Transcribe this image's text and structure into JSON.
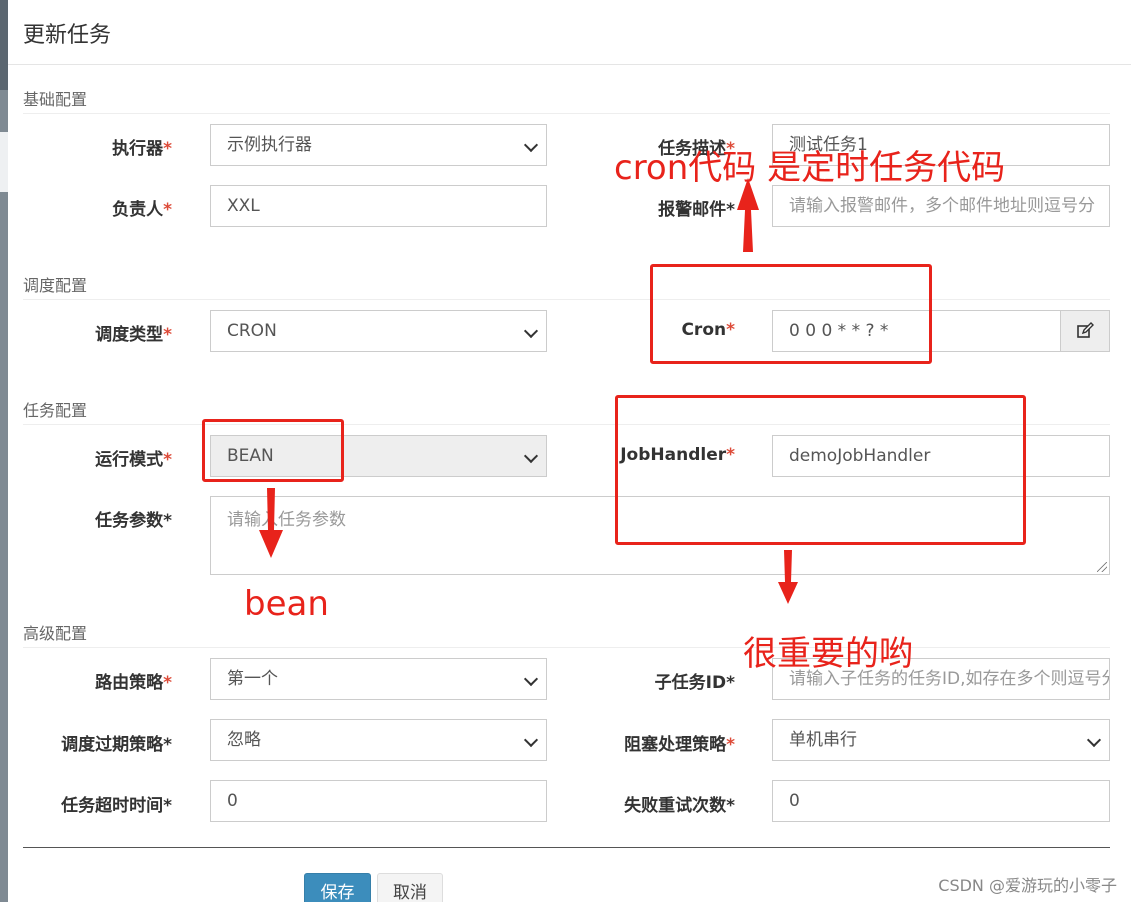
{
  "modal": {
    "title": "更新任务"
  },
  "sections": {
    "basic": "基础配置",
    "schedule": "调度配置",
    "task": "任务配置",
    "advanced": "高级配置"
  },
  "fields": {
    "executor": {
      "label": "执行器",
      "value": "示例执行器"
    },
    "job_desc": {
      "label": "任务描述",
      "value": "测试任务1"
    },
    "author": {
      "label": "负责人",
      "value": "XXL"
    },
    "alarm_email": {
      "label": "报警邮件",
      "placeholder": "请输入报警邮件，多个邮件地址则逗号分"
    },
    "schedule_type": {
      "label": "调度类型",
      "value": "CRON"
    },
    "cron": {
      "label": "Cron",
      "value": "0 0 0 * * ? *"
    },
    "run_mode": {
      "label": "运行模式",
      "value": "BEAN"
    },
    "job_handler": {
      "label": "JobHandler",
      "value": "demoJobHandler"
    },
    "job_param": {
      "label": "任务参数",
      "placeholder": "请输入任务参数"
    },
    "route_strategy": {
      "label": "路由策略",
      "value": "第一个"
    },
    "child_job_id": {
      "label": "子任务ID",
      "placeholder": "请输入子任务的任务ID,如存在多个则逗号分隔"
    },
    "misfire_strategy": {
      "label": "调度过期策略",
      "value": "忽略"
    },
    "block_strategy": {
      "label": "阻塞处理策略",
      "value": "单机串行"
    },
    "timeout": {
      "label": "任务超时时间",
      "value": "0"
    },
    "fail_retry": {
      "label": "失败重试次数",
      "value": "0"
    }
  },
  "buttons": {
    "save": "保存",
    "cancel": "取消"
  },
  "annotations": {
    "cron_note": "cron代码 是定时任务代码",
    "bean_note": "bean",
    "important_note": "很重要的哟",
    "color": "#e8231b"
  },
  "watermark": "CSDN @爱游玩的小零子",
  "icons": {
    "cron_edit": "edit-icon"
  }
}
